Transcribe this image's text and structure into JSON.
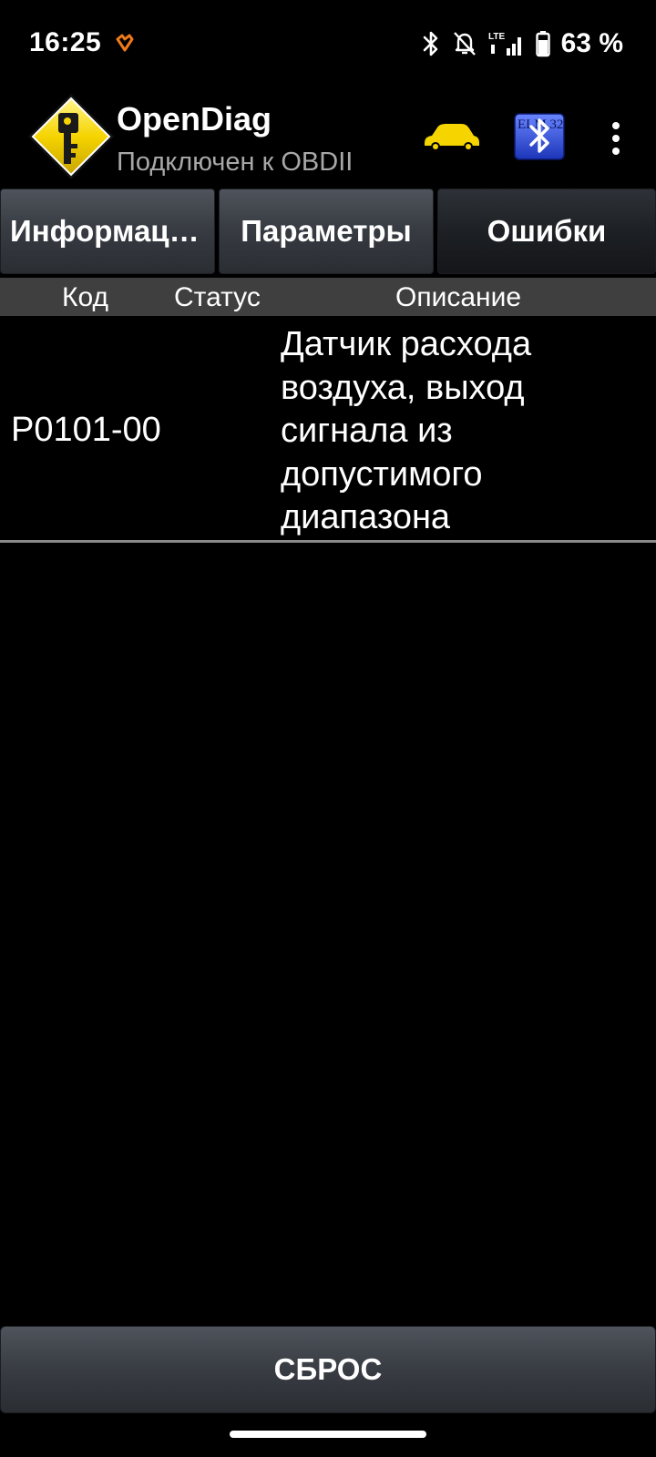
{
  "status_bar": {
    "time": "16:25",
    "battery_percent": "63 %",
    "network": "LTE",
    "icons": [
      "notification-app-icon",
      "bluetooth-icon",
      "mute-bell-icon",
      "signal-icon",
      "battery-icon"
    ]
  },
  "app_bar": {
    "title": "OpenDiag",
    "subtitle": "Подключен к OBDII",
    "logo": "key-road-sign-logo",
    "car_icon": "car-icon",
    "adapter_icon": "bluetooth-elm327-icon",
    "adapter_icon_text": "ELM 327",
    "menu_icon": "more-vert-icon"
  },
  "tabs": [
    {
      "label": "Информация",
      "active": false
    },
    {
      "label": "Параметры",
      "active": false
    },
    {
      "label": "Ошибки",
      "active": true
    }
  ],
  "table": {
    "columns": [
      "Код",
      "Статус",
      "Описание"
    ],
    "rows": [
      {
        "code": "P0101-00",
        "status": "",
        "description": "Датчик расхода воздуха, выход сигнала из допустимого диапазона"
      }
    ]
  },
  "reset_button": {
    "label": "СБРОС"
  },
  "colors": {
    "background": "#000000",
    "accent_yellow": "#f5d400",
    "subtitle_gray": "#a8a8a8",
    "header_row": "#3f3f3f",
    "bluetooth_blue": "#2f4fd8"
  }
}
